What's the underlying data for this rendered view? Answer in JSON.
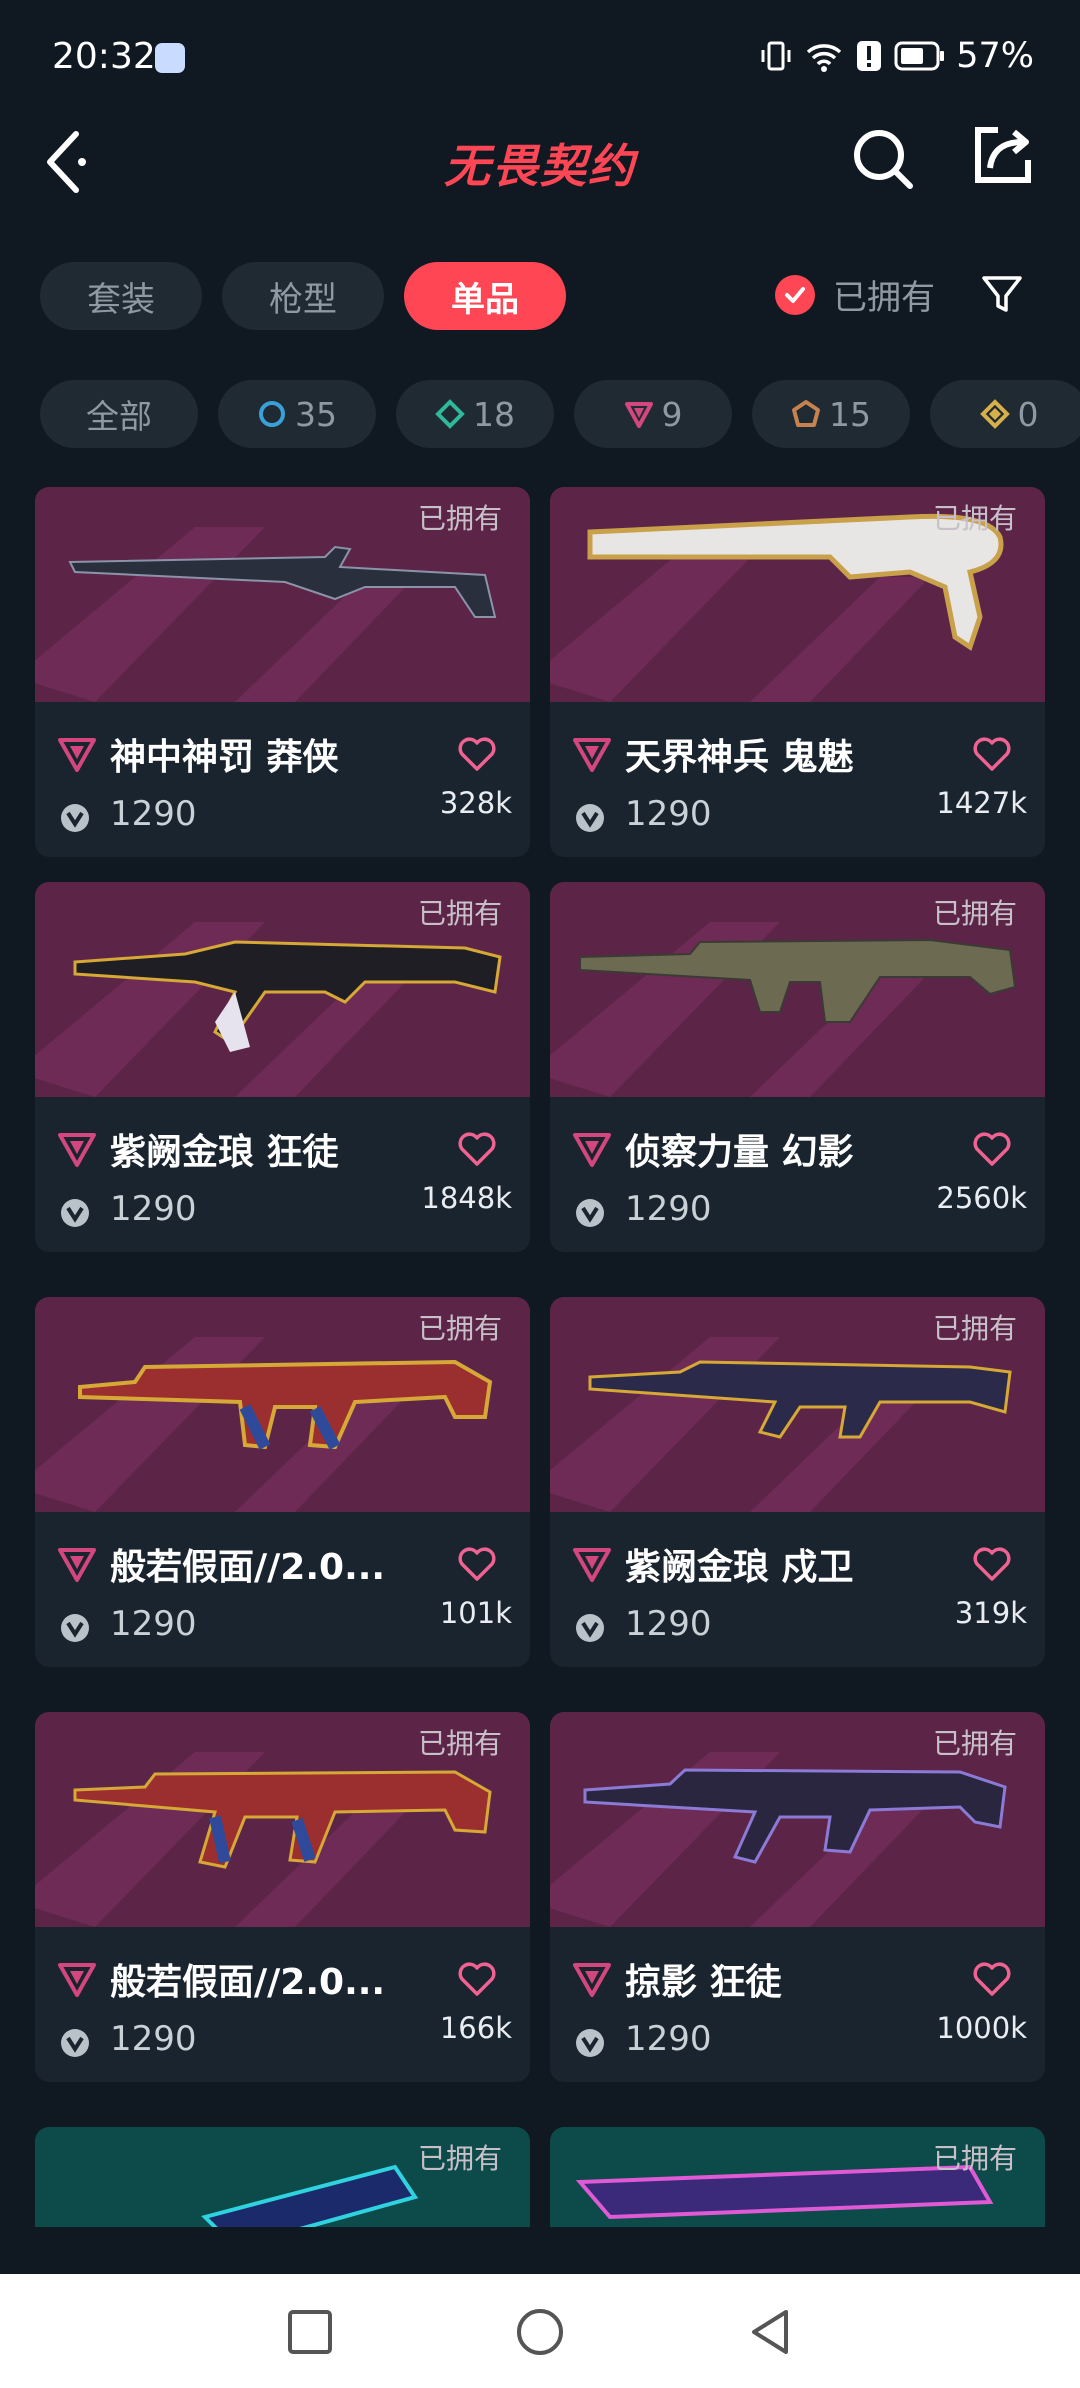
{
  "status": {
    "time": "20:32",
    "battery": "57%"
  },
  "header": {
    "title": "无畏契约"
  },
  "tabs": [
    {
      "label": "套装",
      "active": false
    },
    {
      "label": "枪型",
      "active": false
    },
    {
      "label": "单品",
      "active": true
    }
  ],
  "filter": {
    "owned_label": "已拥有"
  },
  "chips": [
    {
      "label": "全部"
    },
    {
      "label": "35",
      "color": "#3aa0d8"
    },
    {
      "label": "18",
      "color": "#2fb89a"
    },
    {
      "label": "9",
      "color": "#d4467e"
    },
    {
      "label": "15",
      "color": "#c88250"
    },
    {
      "label": "0",
      "color": "#d6b04a"
    }
  ],
  "cards": [
    {
      "name": "神中神罚 莽侠",
      "price": "1290",
      "likes": "328k",
      "owned": "已拥有"
    },
    {
      "name": "天界神兵 鬼魅",
      "price": "1290",
      "likes": "1427k",
      "owned": "已拥有"
    },
    {
      "name": "紫阙金琅 狂徒",
      "price": "1290",
      "likes": "1848k",
      "owned": "已拥有"
    },
    {
      "name": "侦察力量 幻影",
      "price": "1290",
      "likes": "2560k",
      "owned": "已拥有"
    },
    {
      "name": "般若假面//2.0...",
      "price": "1290",
      "likes": "101k",
      "owned": "已拥有"
    },
    {
      "name": "紫阙金琅 戍卫",
      "price": "1290",
      "likes": "319k",
      "owned": "已拥有"
    },
    {
      "name": "般若假面//2.0...",
      "price": "1290",
      "likes": "166k",
      "owned": "已拥有"
    },
    {
      "name": "掠影 狂徒",
      "price": "1290",
      "likes": "1000k",
      "owned": "已拥有"
    },
    {
      "name": "",
      "price": "",
      "likes": "",
      "owned": "已拥有"
    },
    {
      "name": "",
      "price": "",
      "likes": "",
      "owned": "已拥有"
    }
  ],
  "colors": {
    "accent": "#ff4655",
    "background": "#101821",
    "card_art": "#5c2548"
  }
}
